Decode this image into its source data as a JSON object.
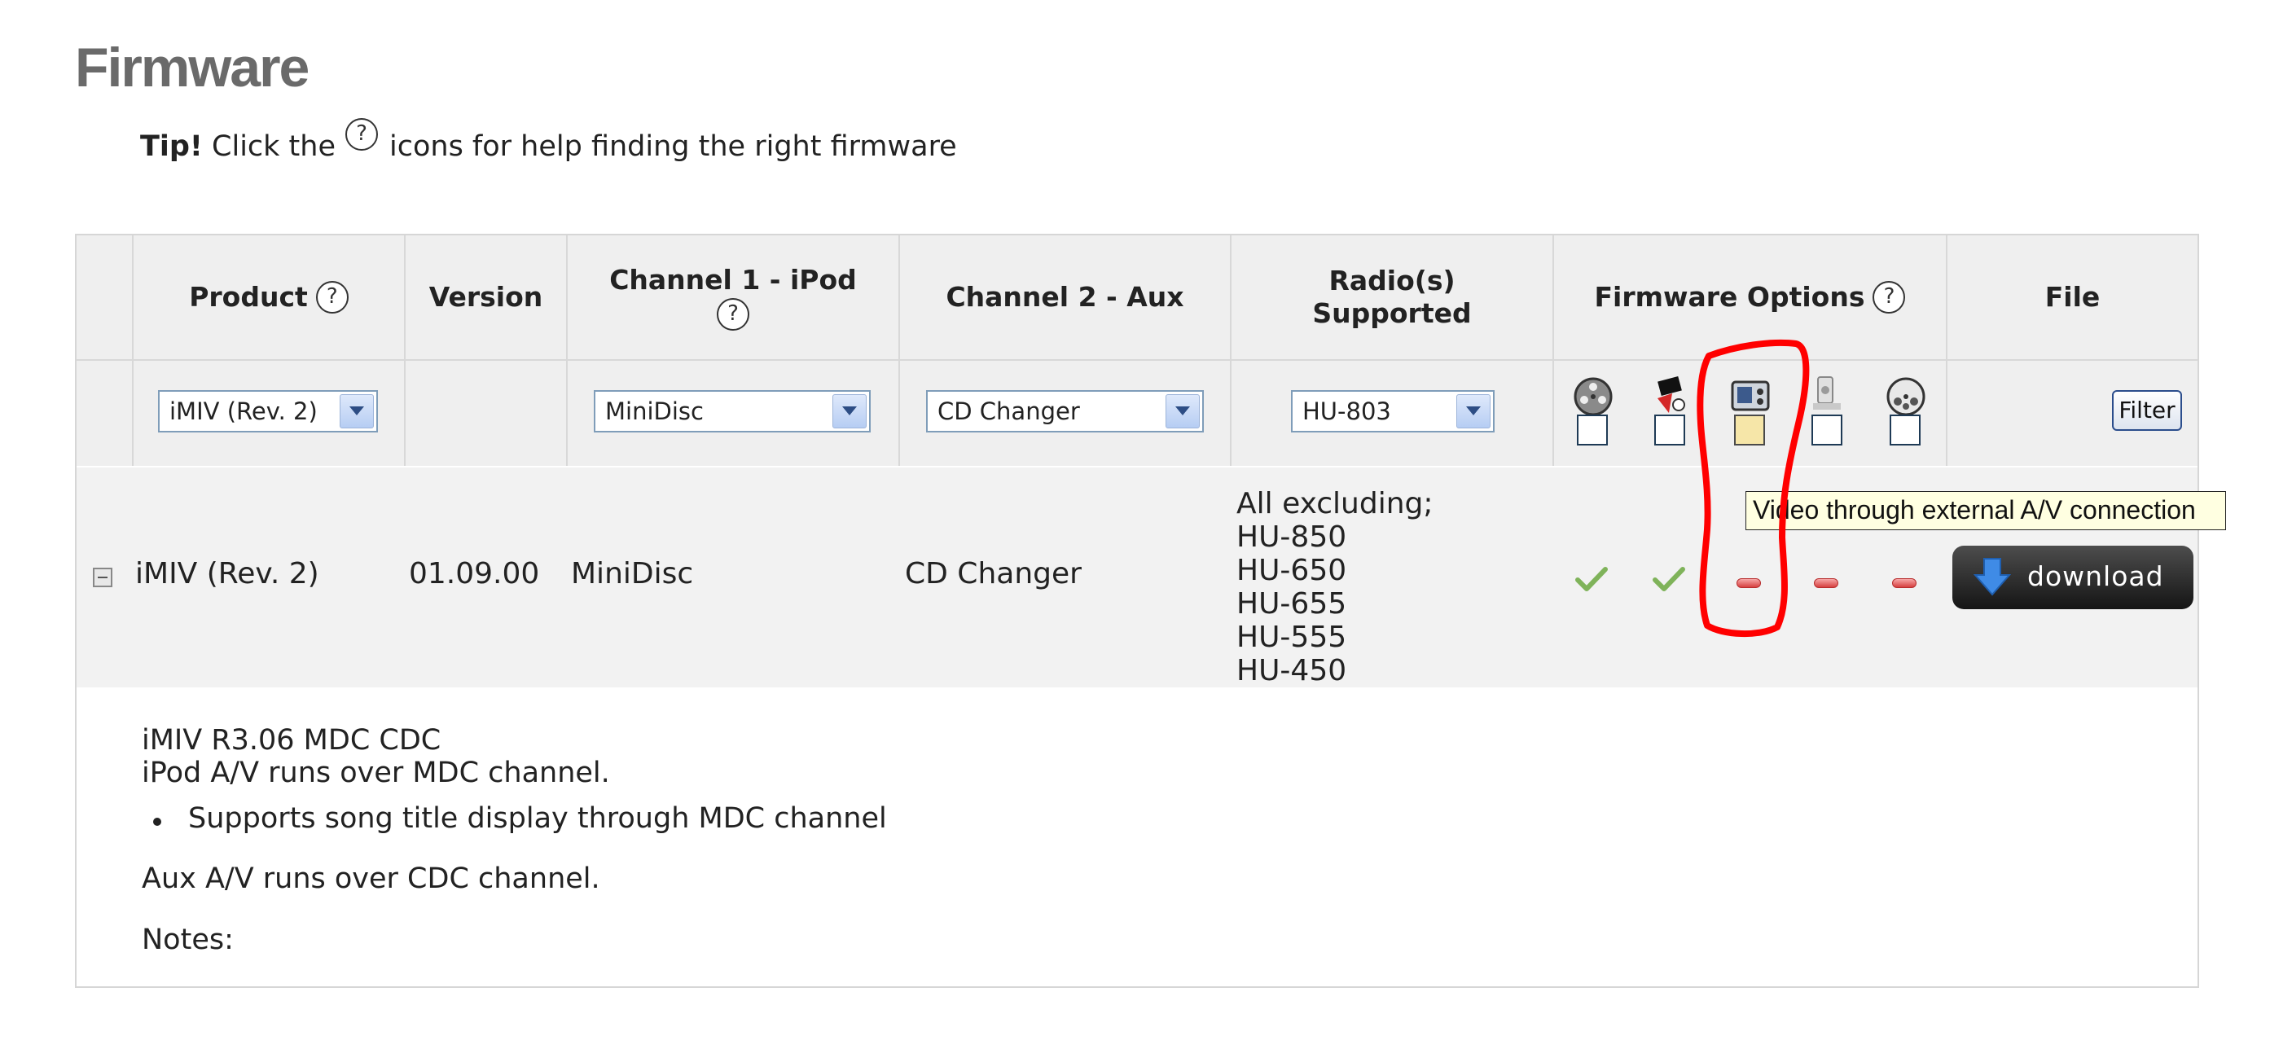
{
  "page": {
    "title": "Firmware"
  },
  "tip": {
    "bold": "Tip!",
    "before": "Click the",
    "after": "icons for help finding the right firmware",
    "help_glyph": "?"
  },
  "table": {
    "headers": {
      "product": "Product",
      "version": "Version",
      "channel1_line1": "Channel 1 - iPod",
      "channel2": "Channel 2 - Aux",
      "radios_line1": "Radio(s)",
      "radios_line2": "Supported",
      "options": "Firmware Options",
      "file": "File"
    },
    "filters": {
      "product": "iMIV (Rev. 2)",
      "channel1": "MiniDisc",
      "channel2": "CD Changer",
      "radio": "HU-803",
      "button": "Filter"
    },
    "option_icons": [
      "film-reel-icon",
      "ipod-video-icon",
      "external-av-icon",
      "accessory-icon",
      "cd-icon"
    ],
    "row": {
      "product": "iMIV (Rev. 2)",
      "version": "01.09.00",
      "channel1": "MiniDisc",
      "channel2": "CD Changer",
      "radios": [
        "All excluding;",
        "HU-850",
        "HU-650",
        "HU-655",
        "HU-555",
        "HU-450"
      ],
      "options": [
        "yes",
        "yes",
        "no",
        "no",
        "no"
      ],
      "download_label": "download"
    }
  },
  "tooltip": "Video through external A/V connection",
  "details": {
    "line1": "iMIV R3.06 MDC CDC",
    "line2": "iPod A/V runs over MDC channel.",
    "bullet": "Supports song title display through MDC channel",
    "line3": "Aux A/V runs over CDC channel.",
    "notes": "Notes:"
  },
  "colors": {
    "title": "#6a6a6a",
    "header_bg": "#efefef",
    "row_bg": "#f2f2f2",
    "annotation": "#ff0000"
  }
}
